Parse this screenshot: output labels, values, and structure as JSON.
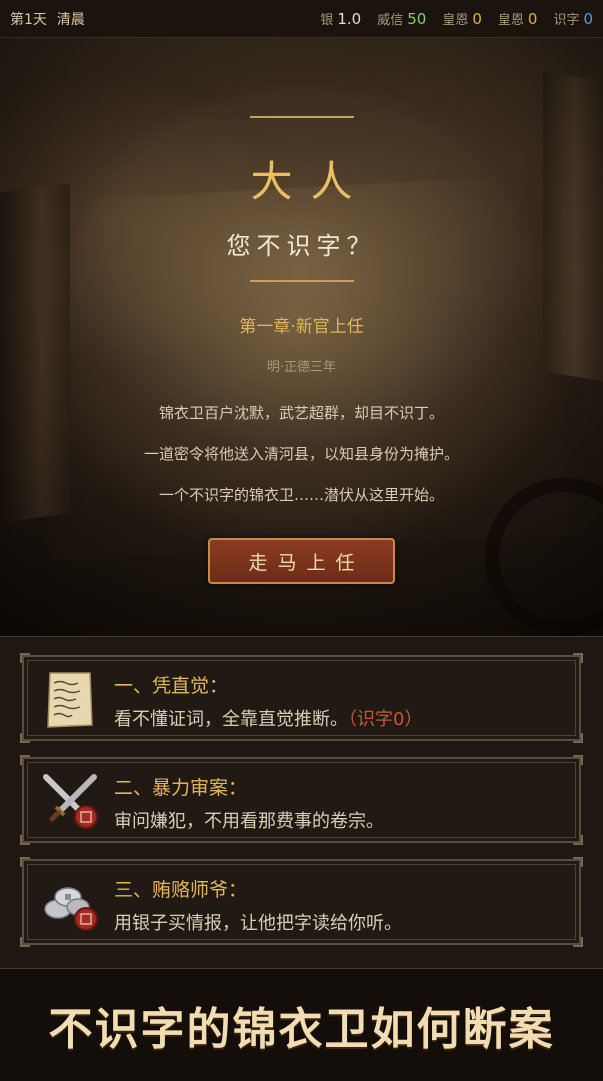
{
  "topbar": {
    "day": "第1天",
    "period": "清晨",
    "stats": [
      {
        "label": "银",
        "value": "1.0",
        "color": "#e8dcc4"
      },
      {
        "label": "威信",
        "value": "50",
        "color": "#7fd36a"
      },
      {
        "label": "皇恩",
        "value": "0",
        "color": "#e0b040"
      },
      {
        "label": "皇恩",
        "value": "0",
        "color": "#e0b040"
      },
      {
        "label": "识字",
        "value": "0",
        "color": "#5a9be0"
      }
    ]
  },
  "intro": {
    "title": "大人",
    "subtitle": "您不识字？",
    "chapter": "第一章·新官上任",
    "era": "明·正德三年",
    "story": [
      "锦衣卫百户沈默，武艺超群，却目不识丁。",
      "一道密令将他送入清河县，以知县身份为掩护。",
      "一个不识字的锦衣卫……潜伏从这里开始。"
    ],
    "start_button": "走马上任"
  },
  "options": [
    {
      "name": "一、凭直觉：",
      "desc": "看不懂证词，全靠直觉推断。",
      "tag": "（识字0）",
      "icon": "paper-scroll-icon"
    },
    {
      "name": "二、暴力审案：",
      "desc": "审问嫌犯，不用看那费事的卷宗。",
      "tag": "",
      "icon": "crossed-swords-icon"
    },
    {
      "name": "三、贿赂师爷：",
      "desc": "用银子买情报，让他把字读给你听。",
      "tag": "",
      "icon": "silver-coins-icon"
    }
  ],
  "slogan": "不识字的锦衣卫如何断案"
}
